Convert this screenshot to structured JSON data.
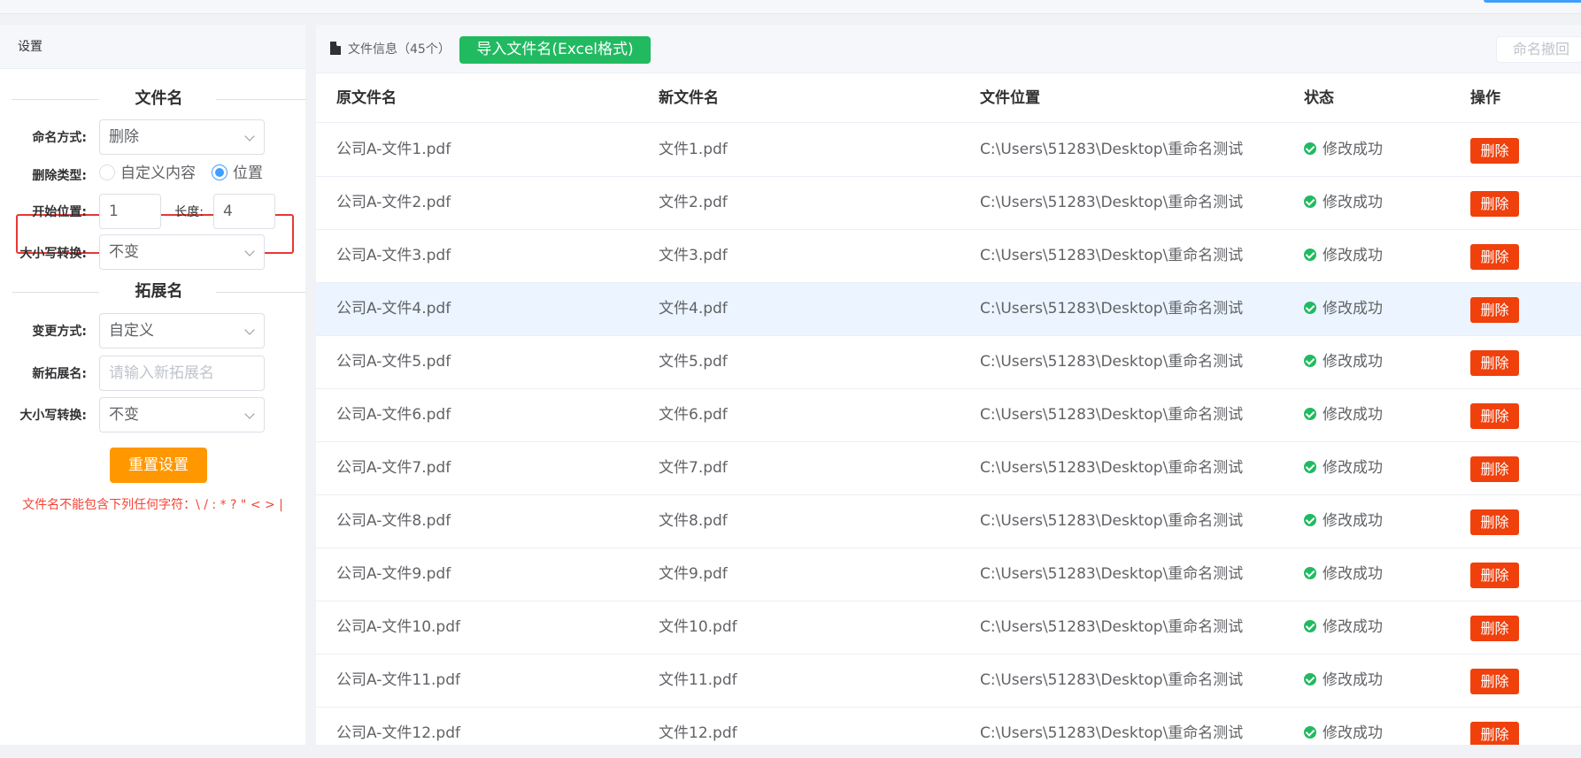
{
  "left": {
    "title": "设置",
    "filename_section": "文件名",
    "naming_mode_label": "命名方式:",
    "naming_mode_value": "删除",
    "delete_type_label": "删除类型:",
    "delete_type_options": [
      "自定义内容",
      "位置"
    ],
    "delete_type_selected": "位置",
    "start_pos_label": "开始位置:",
    "start_pos_value": "1",
    "length_label": "长度:",
    "length_value": "4",
    "case_label": "大小写转换:",
    "case_value": "不变",
    "ext_section": "拓展名",
    "change_mode_label": "变更方式:",
    "change_mode_value": "自定义",
    "new_ext_label": "新拓展名:",
    "new_ext_placeholder": "请输入新拓展名",
    "ext_case_label": "大小写转换:",
    "ext_case_value": "不变",
    "reset_label": "重置设置",
    "warning": "文件名不能包含下列任何字符：\\ / : * ? \" < > |"
  },
  "right": {
    "file_info": "文件信息（45个）",
    "import_label": "导入文件名(Excel格式)",
    "undo_label": "命名撤回",
    "columns": [
      "原文件名",
      "新文件名",
      "文件位置",
      "状态",
      "操作"
    ],
    "delete_label": "删除",
    "rows": [
      {
        "orig": "公司A-文件1.pdf",
        "new": "文件1.pdf",
        "path": "C:\\Users\\51283\\Desktop\\重命名测试",
        "status": "修改成功"
      },
      {
        "orig": "公司A-文件2.pdf",
        "new": "文件2.pdf",
        "path": "C:\\Users\\51283\\Desktop\\重命名测试",
        "status": "修改成功"
      },
      {
        "orig": "公司A-文件3.pdf",
        "new": "文件3.pdf",
        "path": "C:\\Users\\51283\\Desktop\\重命名测试",
        "status": "修改成功"
      },
      {
        "orig": "公司A-文件4.pdf",
        "new": "文件4.pdf",
        "path": "C:\\Users\\51283\\Desktop\\重命名测试",
        "status": "修改成功",
        "hover": true
      },
      {
        "orig": "公司A-文件5.pdf",
        "new": "文件5.pdf",
        "path": "C:\\Users\\51283\\Desktop\\重命名测试",
        "status": "修改成功"
      },
      {
        "orig": "公司A-文件6.pdf",
        "new": "文件6.pdf",
        "path": "C:\\Users\\51283\\Desktop\\重命名测试",
        "status": "修改成功"
      },
      {
        "orig": "公司A-文件7.pdf",
        "new": "文件7.pdf",
        "path": "C:\\Users\\51283\\Desktop\\重命名测试",
        "status": "修改成功"
      },
      {
        "orig": "公司A-文件8.pdf",
        "new": "文件8.pdf",
        "path": "C:\\Users\\51283\\Desktop\\重命名测试",
        "status": "修改成功"
      },
      {
        "orig": "公司A-文件9.pdf",
        "new": "文件9.pdf",
        "path": "C:\\Users\\51283\\Desktop\\重命名测试",
        "status": "修改成功"
      },
      {
        "orig": "公司A-文件10.pdf",
        "new": "文件10.pdf",
        "path": "C:\\Users\\51283\\Desktop\\重命名测试",
        "status": "修改成功"
      },
      {
        "orig": "公司A-文件11.pdf",
        "new": "文件11.pdf",
        "path": "C:\\Users\\51283\\Desktop\\重命名测试",
        "status": "修改成功"
      },
      {
        "orig": "公司A-文件12.pdf",
        "new": "文件12.pdf",
        "path": "C:\\Users\\51283\\Desktop\\重命名测试",
        "status": "修改成功"
      }
    ]
  },
  "colors": {
    "accent": "#409eff",
    "success": "#21ba61",
    "danger": "#f0400c",
    "warning": "#ff9800",
    "highlight": "#e53935"
  }
}
